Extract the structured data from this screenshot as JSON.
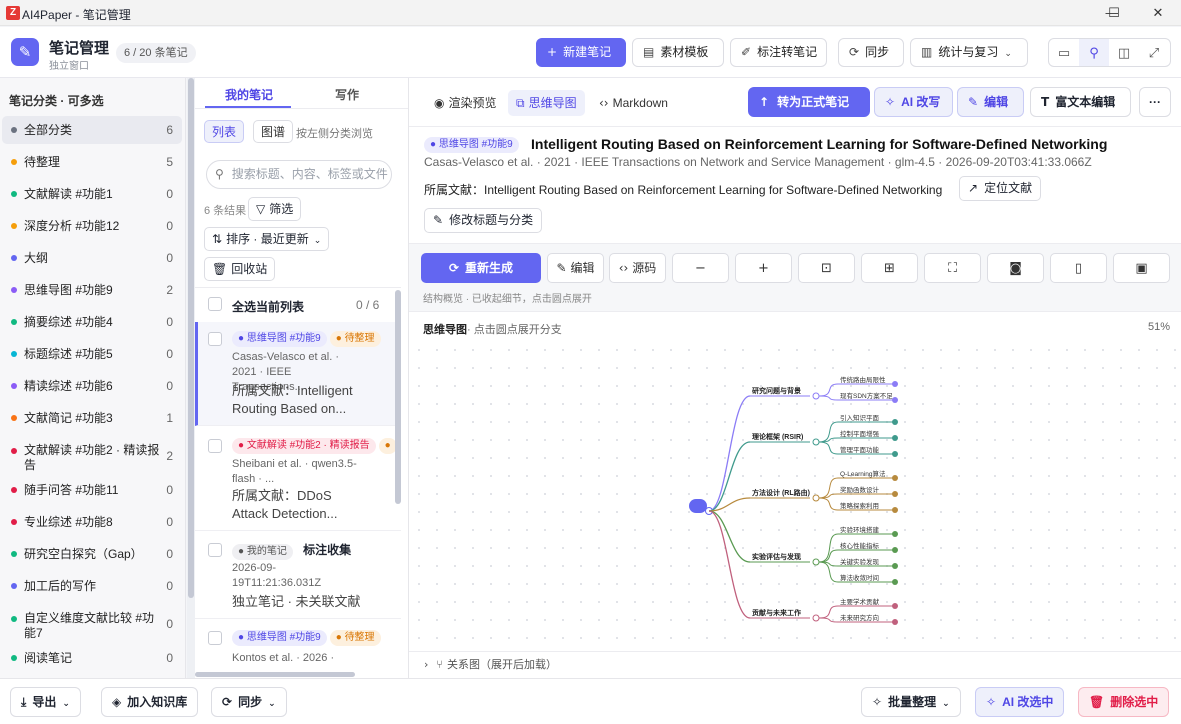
{
  "window": {
    "logo": "Z",
    "title": "AI4Paper - 笔记管理",
    "controls": [
      "—",
      "☐",
      "✕"
    ]
  },
  "header": {
    "title": "笔记管理",
    "subtitle": "独立窗口",
    "count": "6 / 20 条笔记",
    "buttons": {
      "new_note": "新建笔记",
      "templates": "素材模板",
      "annotate": "标注转笔记",
      "sync": "同步",
      "stats": "统计与复习"
    }
  },
  "sidebar": {
    "title": "笔记分类 · 可多选",
    "items": [
      {
        "label": "全部分类",
        "count": "6",
        "color": "#6b7280"
      },
      {
        "label": "待整理",
        "count": "5",
        "color": "#f59e0b"
      },
      {
        "label": "文献解读 #功能1",
        "count": "0",
        "color": "#10b981"
      },
      {
        "label": "深度分析 #功能12",
        "count": "0",
        "color": "#f59e0b"
      },
      {
        "label": "大纲",
        "count": "0",
        "color": "#6366f1"
      },
      {
        "label": "思维导图 #功能9",
        "count": "2",
        "color": "#8b5cf6"
      },
      {
        "label": "摘要综述 #功能4",
        "count": "0",
        "color": "#10b981"
      },
      {
        "label": "标题综述 #功能5",
        "count": "0",
        "color": "#06b6d4"
      },
      {
        "label": "精读综述 #功能6",
        "count": "0",
        "color": "#8b5cf6"
      },
      {
        "label": "文献简记 #功能3",
        "count": "1",
        "color": "#f97316"
      },
      {
        "label": "文献解读 #功能2 · 精读报告",
        "count": "2",
        "color": "#e11d48"
      },
      {
        "label": "随手问答 #功能11",
        "count": "0",
        "color": "#e11d48"
      },
      {
        "label": "专业综述 #功能8",
        "count": "0",
        "color": "#e11d48"
      },
      {
        "label": "研究空白探究（Gap）",
        "count": "0",
        "color": "#10b981"
      },
      {
        "label": "加工后的写作",
        "count": "0",
        "color": "#6366f1"
      },
      {
        "label": "自定义维度文献比较 #功能7",
        "count": "0",
        "color": "#10b981"
      },
      {
        "label": "阅读笔记",
        "count": "0",
        "color": "#10b981"
      }
    ]
  },
  "notes": {
    "tabs": [
      "我的笔记",
      "写作"
    ],
    "views": [
      "列表",
      "图谱"
    ],
    "view_hint": "按左侧分类浏览",
    "search_placeholder": "搜索标题、内容、标签或文件",
    "results": "6 条结果",
    "filter": "筛选",
    "sort": "排序 · 最近更新",
    "recycle": "回收站",
    "select_all": "全选当前列表",
    "selected_count": "0 / 6",
    "cards": [
      {
        "tag1": "思维导图 #功能9",
        "tag2": "待整理",
        "meta": "Casas-Velasco et al. · 2021 · IEEE Transactions...",
        "doc": "所属文献：Intelligent Routing Based on..."
      },
      {
        "tag1": "文献解读 #功能2 · 精读报告",
        "tag2": "",
        "meta": "Sheibani et al. · qwen3.5-flash · ...",
        "doc": "所属文献：DDoS Attack Detection..."
      },
      {
        "tag1": "我的笔记",
        "title": "标注收集",
        "meta": "2026-09-19T11:21:36.031Z",
        "doc": "独立笔记 · 未关联文献"
      },
      {
        "tag1": "思维导图 #功能9",
        "tag2": "待整理",
        "meta": "Kontos et al. · 2026 ·",
        "doc": ""
      }
    ]
  },
  "main": {
    "tabs": [
      "渲染预览",
      "思维导图",
      "Markdown"
    ],
    "actions": {
      "convert": "转为正式笔记",
      "ai_rewrite": "AI 改写",
      "edit": "编辑",
      "rich_edit": "富文本编辑",
      "more": "···"
    },
    "note": {
      "tag": "思维导图 #功能9",
      "title": "Intelligent Routing Based on Reinforcement Learning for Software-Defined Networking",
      "meta": "Casas-Velasco et al. · 2021 · IEEE Transactions on Network and Service Management · glm-4.5 · 2026-09-20T03:41:33.066Z",
      "source": "所属文献：Intelligent Routing Based on Reinforcement Learning for Software-Defined Networking",
      "locate": "定位文献",
      "edit_meta": "修改标题与分类"
    },
    "toolbar": {
      "regenerate": "重新生成",
      "edit": "编辑",
      "source": "源码",
      "hint": "结构概览 · 已收起细节，点击圆点展开"
    },
    "mindmap": {
      "label": "思维导图",
      "label_hint": "· 点击圆点展开分支",
      "zoom": "51%",
      "branches": [
        {
          "label": "研究问题与背景",
          "color": "#8b7cf6",
          "leaves": [
            "传统路由局限性",
            "现有SDN方案不足"
          ]
        },
        {
          "label": "理论框架 (RSIR)",
          "color": "#3f9a8c",
          "leaves": [
            "引入知识平面",
            "控制平面增强",
            "管理平面功能"
          ]
        },
        {
          "label": "方法设计 (RL路由)",
          "color": "#b78a3e",
          "leaves": [
            "Q-Learning算法",
            "奖励函数设计",
            "策略探索利用"
          ]
        },
        {
          "label": "实验评估与发现",
          "color": "#5a9a52",
          "leaves": [
            "实验环境搭建",
            "核心性能指标",
            "关键实验发现",
            "算法收敛时间"
          ]
        },
        {
          "label": "贡献与未来工作",
          "color": "#c0607d",
          "leaves": [
            "主要学术贡献",
            "未来研究方向"
          ]
        }
      ]
    },
    "relation": "关系图（展开后加载）"
  },
  "footer": {
    "export": "导出",
    "add_kb": "加入知识库",
    "sync": "同步",
    "batch": "批量整理",
    "ai_rewrite_sel": "AI 改选中",
    "delete_sel": "删除选中"
  }
}
